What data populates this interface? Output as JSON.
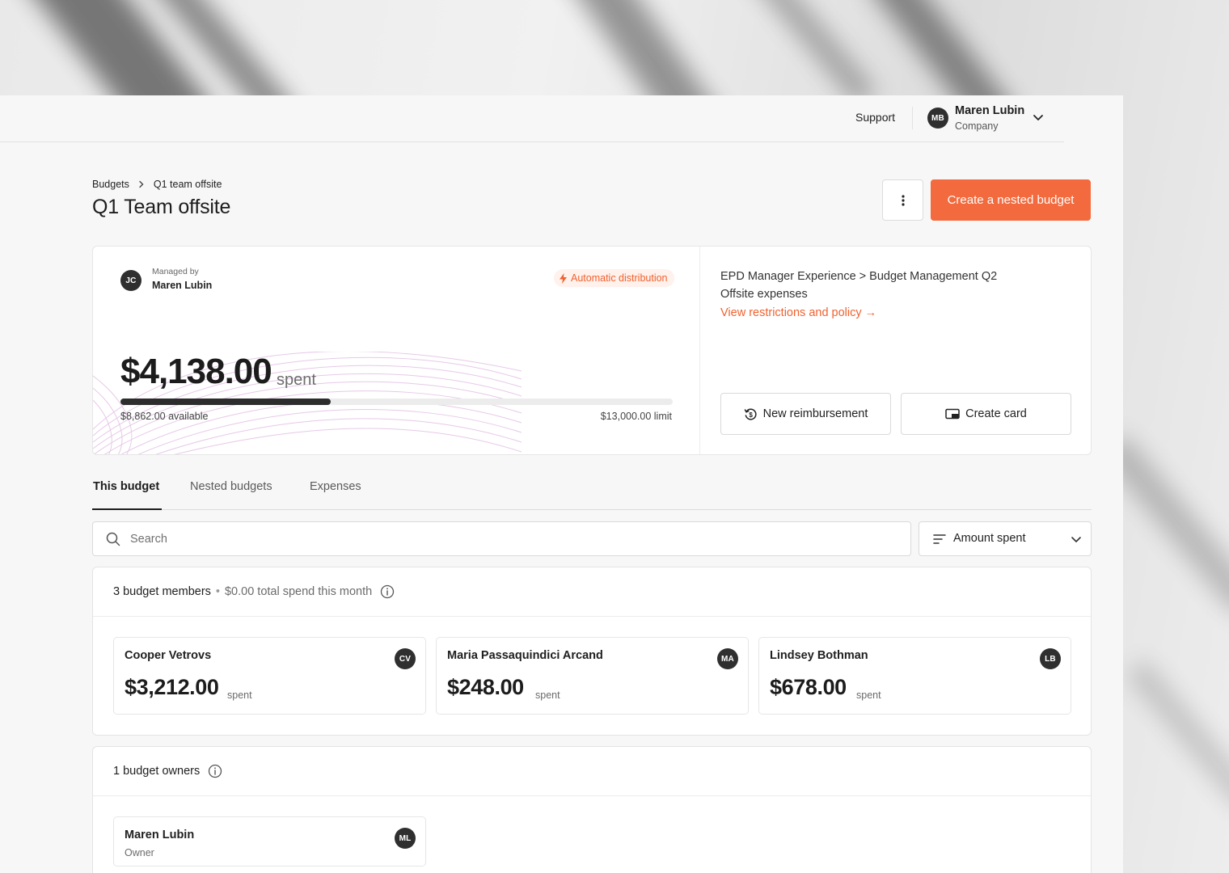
{
  "topbar": {
    "support_label": "Support",
    "user": {
      "initials": "MB",
      "name": "Maren Lubin",
      "org": "Company"
    }
  },
  "breadcrumb": {
    "root": "Budgets",
    "current": "Q1 team offsite"
  },
  "page": {
    "title": "Q1 Team offsite",
    "more_icon": "vertical-dots-icon",
    "create_button": "Create a nested budget"
  },
  "summary": {
    "manager": {
      "initials": "JC",
      "label": "Managed by",
      "name": "Maren Lubin"
    },
    "badge": "Automatic distribution",
    "spent_amount": "$4,138.00",
    "spent_word": "spent",
    "progress_fraction": 0.38,
    "available": "$8,862.00 available",
    "limit": "$13,000.00 limit",
    "path": "EPD Manager Experience > Budget Management Q2",
    "category": "Offsite expenses",
    "policy_link": "View restrictions and policy →",
    "reimbursement_button": "New reimbursement",
    "create_card_button": "Create card"
  },
  "tabs": [
    {
      "label": "This budget",
      "active": true
    },
    {
      "label": "Nested budgets",
      "active": false
    },
    {
      "label": "Expenses",
      "active": false
    }
  ],
  "search": {
    "placeholder": "Search",
    "value": ""
  },
  "sort": {
    "label": "Amount spent"
  },
  "members": {
    "title": "3 budget members",
    "subtitle": "$0.00 total spend this month",
    "cards": [
      {
        "name": "Cooper Vetrovs",
        "initials": "CV",
        "amount": "$3,212.00",
        "spent": "spent"
      },
      {
        "name": "Maria Passaquindici Arcand",
        "initials": "MA",
        "amount": "$248.00",
        "spent": "spent"
      },
      {
        "name": "Lindsey Bothman",
        "initials": "LB",
        "amount": "$678.00",
        "spent": "spent"
      }
    ]
  },
  "owners": {
    "title": "1 budget owners",
    "cards": [
      {
        "name": "Maren Lubin",
        "initials": "ML",
        "role": "Owner"
      }
    ]
  },
  "colors": {
    "accent": "#f26a3d",
    "dark": "#2d2d2d",
    "page_bg": "#f7f7f7"
  }
}
